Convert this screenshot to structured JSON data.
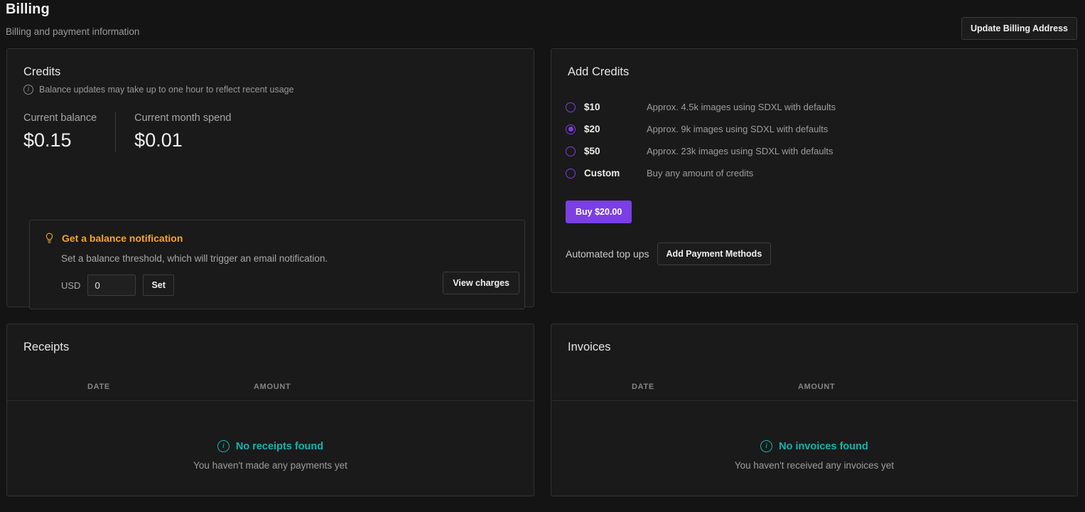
{
  "header": {
    "title": "Billing",
    "subtitle": "Billing and payment information",
    "update_billing_label": "Update Billing Address"
  },
  "credits": {
    "title": "Credits",
    "balance_note": "Balance updates may take up to one hour to reflect recent usage",
    "stats": [
      {
        "label": "Current balance",
        "value": "$0.15"
      },
      {
        "label": "Current month spend",
        "value": "$0.01"
      }
    ],
    "notification": {
      "title": "Get a balance notification",
      "description": "Set a balance threshold, which will trigger an email notification.",
      "currency_label": "USD",
      "threshold_value": "0",
      "set_label": "Set"
    },
    "view_charges_label": "View charges"
  },
  "add_credits": {
    "title": "Add Credits",
    "options": [
      {
        "label": "$10",
        "description": "Approx. 4.5k images using SDXL with defaults",
        "selected": false
      },
      {
        "label": "$20",
        "description": "Approx. 9k images using SDXL with defaults",
        "selected": true
      },
      {
        "label": "$50",
        "description": "Approx. 23k images using SDXL with defaults",
        "selected": false
      },
      {
        "label": "Custom",
        "description": "Buy any amount of credits",
        "selected": false
      }
    ],
    "buy_label": "Buy $20.00",
    "automated_topups_label": "Automated top ups",
    "add_payment_label": "Add Payment Methods"
  },
  "receipts": {
    "title": "Receipts",
    "columns": [
      "DATE",
      "AMOUNT"
    ],
    "rows": [],
    "empty_title": "No receipts found",
    "empty_sub": "You haven't made any payments yet"
  },
  "invoices": {
    "title": "Invoices",
    "columns": [
      "DATE",
      "AMOUNT"
    ],
    "rows": [],
    "empty_title": "No invoices found",
    "empty_sub": "You haven't received any invoices yet"
  },
  "colors": {
    "page_bg": "#141414",
    "card_bg": "#1a1a1a",
    "accent_purple": "#7b3fe4",
    "accent_orange": "#f5a623",
    "accent_teal": "#12b5b0"
  }
}
